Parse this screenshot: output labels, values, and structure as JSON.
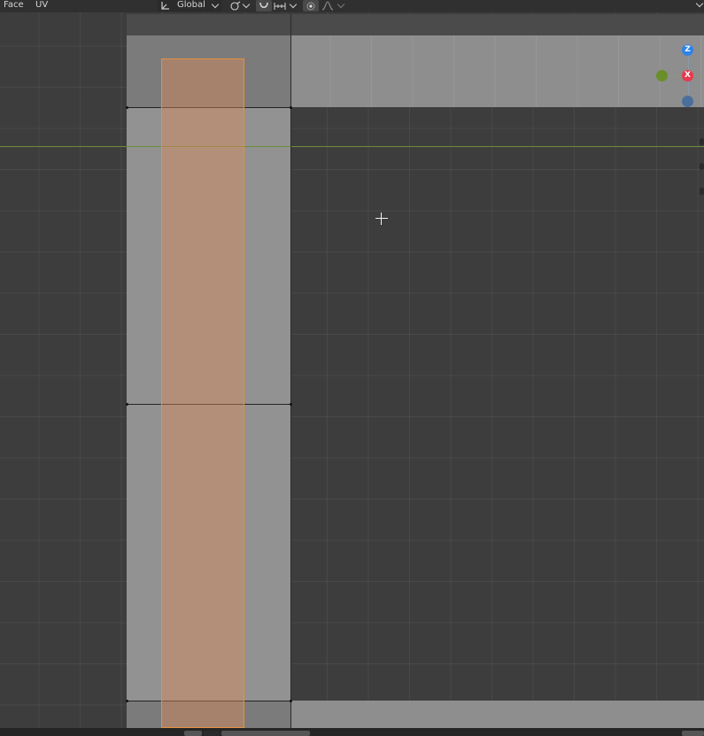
{
  "header": {
    "menus": [
      {
        "label": "Face"
      },
      {
        "label": "UV"
      }
    ],
    "orientation": {
      "value": "Global",
      "icon": "transform-orientation-icon"
    },
    "pivot_icon": "pivot-point-icon",
    "snap_icon": "snap-magnet-icon",
    "snap_target_icon": "snap-increment-icon",
    "proportional_icon": "proportional-edit-icon",
    "falloff_icon": "falloff-curve-icon"
  },
  "gizmo": {
    "z_label": "Z",
    "x_label": "X",
    "colors": {
      "x": "#e8384f",
      "y": "#6a8f2a",
      "z": "#2f83e6",
      "z_neg": "#4b6f9c"
    }
  },
  "colors": {
    "selection_fill": "#db8c5c",
    "selection_edge": "#e3903f",
    "y_axis_line": "#6f8b3a",
    "grid_background": "#3d3d3d"
  }
}
